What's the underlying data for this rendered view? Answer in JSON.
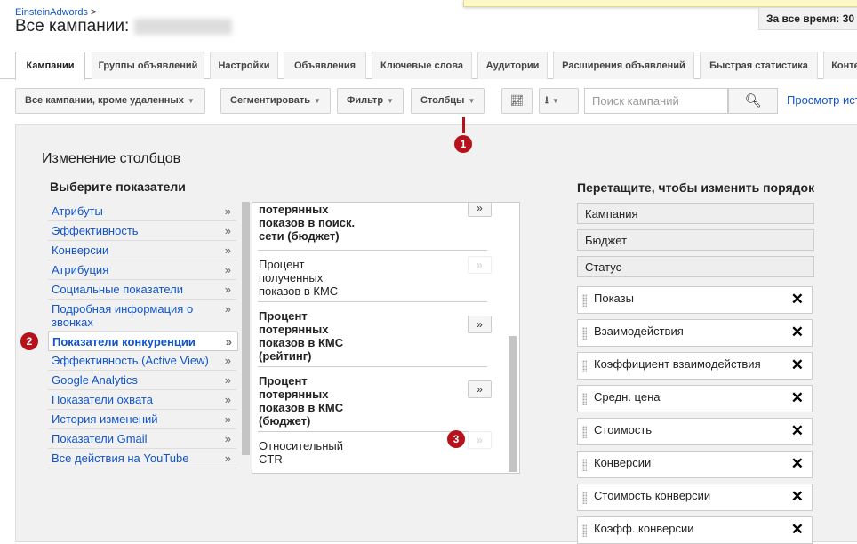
{
  "header": {
    "breadcrumb": "EinsteinAdwords",
    "breadcrumb_sep": ">",
    "title": "Все кампании:",
    "date_range": "За все время: 30"
  },
  "tabs": [
    "Кампании",
    "Группы объявлений",
    "Настройки",
    "Объявления",
    "Ключевые слова",
    "Аудитории",
    "Расширения объявлений",
    "Быстрая статистика",
    "Конте"
  ],
  "toolbar": {
    "campaign_filter": "Все кампании, кроме удаленных",
    "segment": "Сегментировать",
    "filter": "Фильтр",
    "columns": "Столбцы",
    "search_placeholder": "Поиск кампаний",
    "history_link": "Просмотр ист"
  },
  "panel": {
    "title": "Изменение столбцов",
    "metrics_heading": "Выберите показатели",
    "order_heading": "Перетащите, чтобы изменить порядок",
    "categories": [
      "Атрибуты",
      "Эффективность",
      "Конверсии",
      "Атрибуция",
      "Социальные показатели",
      "Подробная информация о звонках",
      "Показатели конкуренции",
      "Эффективность (Active View)",
      "Google Analytics",
      "Показатели охвата",
      "История изменений",
      "Показатели Gmail",
      "Все действия на YouTube"
    ],
    "selected_category": "Показатели конкуренции",
    "metrics": [
      {
        "label": "потерянных показов в поиск. сети (бюджет)",
        "bold": true,
        "enabled": true
      },
      {
        "label": "Процент полученных показов в КМС",
        "bold": false,
        "enabled": false
      },
      {
        "label": "Процент потерянных показов в КМС (рейтинг)",
        "bold": true,
        "enabled": true
      },
      {
        "label": "Процент потерянных показов в КМС (бюджет)",
        "bold": true,
        "enabled": true
      },
      {
        "label": "Относительный CTR",
        "bold": false,
        "enabled": false
      }
    ],
    "add_symbol": "»",
    "fixed_columns": [
      "Кампания",
      "Бюджет",
      "Статус"
    ],
    "columns": [
      "Показы",
      "Взаимодействия",
      "Коэффициент взаимодействия",
      "Средн. цена",
      "Стоимость",
      "Конверсии",
      "Стоимость конверсии",
      "Коэфф. конверсии"
    ],
    "remove_symbol": "✕"
  },
  "annotations": [
    "1",
    "2",
    "3"
  ],
  "colors": {
    "link": "#1155cc",
    "badge": "#b5121b",
    "panel_bg": "#f1f1f1"
  }
}
